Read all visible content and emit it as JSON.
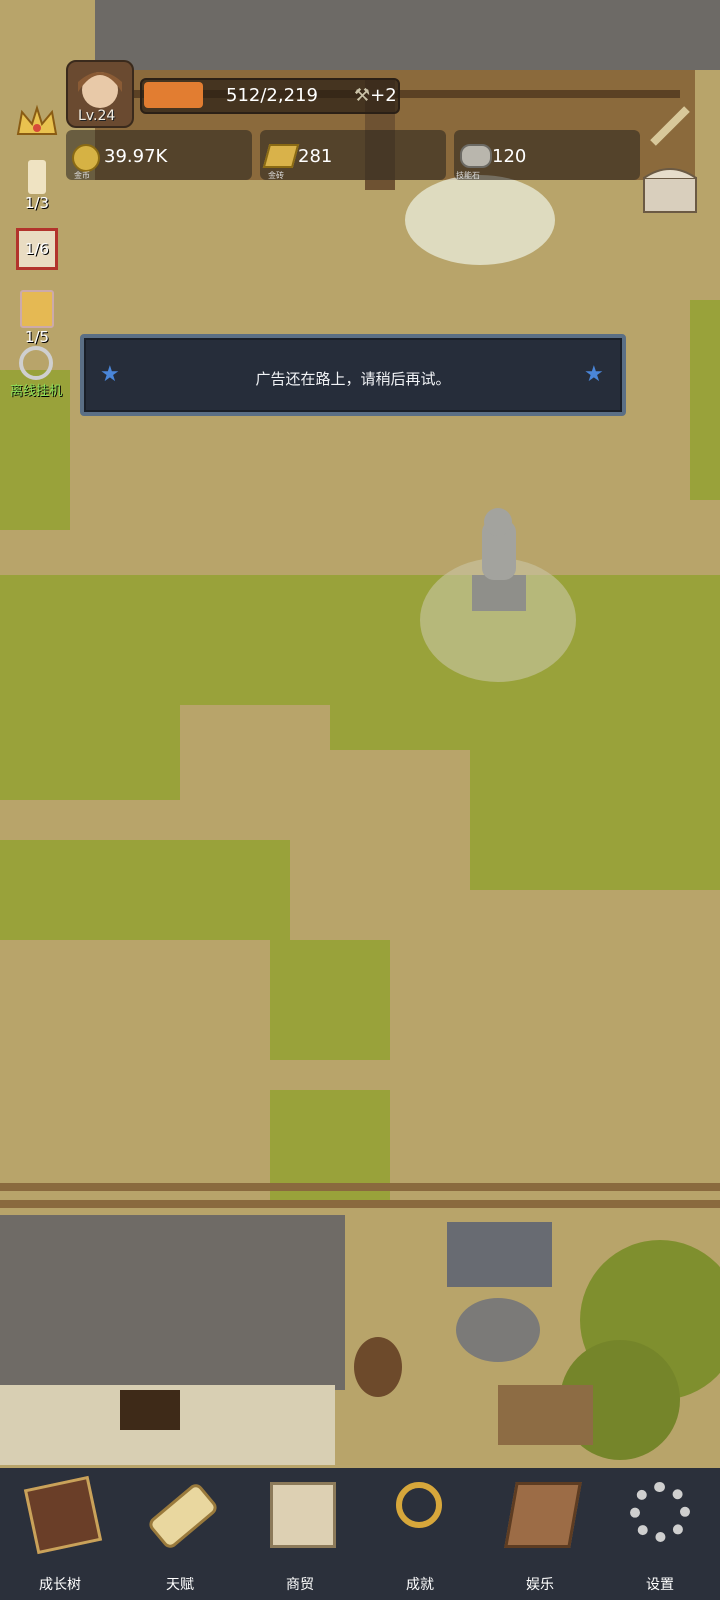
{
  "player": {
    "level": "Lv.24",
    "xp": "512/2,219",
    "xp_fraction": 0.23,
    "xp_bonus": "+2"
  },
  "resources": [
    {
      "value": "39.97K",
      "label": "金币",
      "icon": "gold-coin-icon"
    },
    {
      "value": "281",
      "label": "金砖",
      "icon": "gold-bar-icon"
    },
    {
      "value": "120",
      "label": "技能石",
      "icon": "skill-stone-icon"
    }
  ],
  "side": {
    "candle_count": "1/3",
    "dice_count": "1/6",
    "drink_count": "1/5",
    "idle_label": "离线挂机"
  },
  "toast": {
    "message": "广告还在路上，请稍后再试。"
  },
  "nav": [
    {
      "label": "成长树",
      "icon": "book-icon"
    },
    {
      "label": "天赋",
      "icon": "scroll-icon"
    },
    {
      "label": "商贸",
      "icon": "map-icon"
    },
    {
      "label": "成就",
      "icon": "key-icon"
    },
    {
      "label": "娱乐",
      "icon": "banner-icon"
    },
    {
      "label": "设置",
      "icon": "gear-icon"
    }
  ],
  "colors": {
    "xp_fill": "#e27d31",
    "nav_bg": "#2b303b",
    "toast_bg": "#262d3a",
    "star": "#4a86d9"
  }
}
